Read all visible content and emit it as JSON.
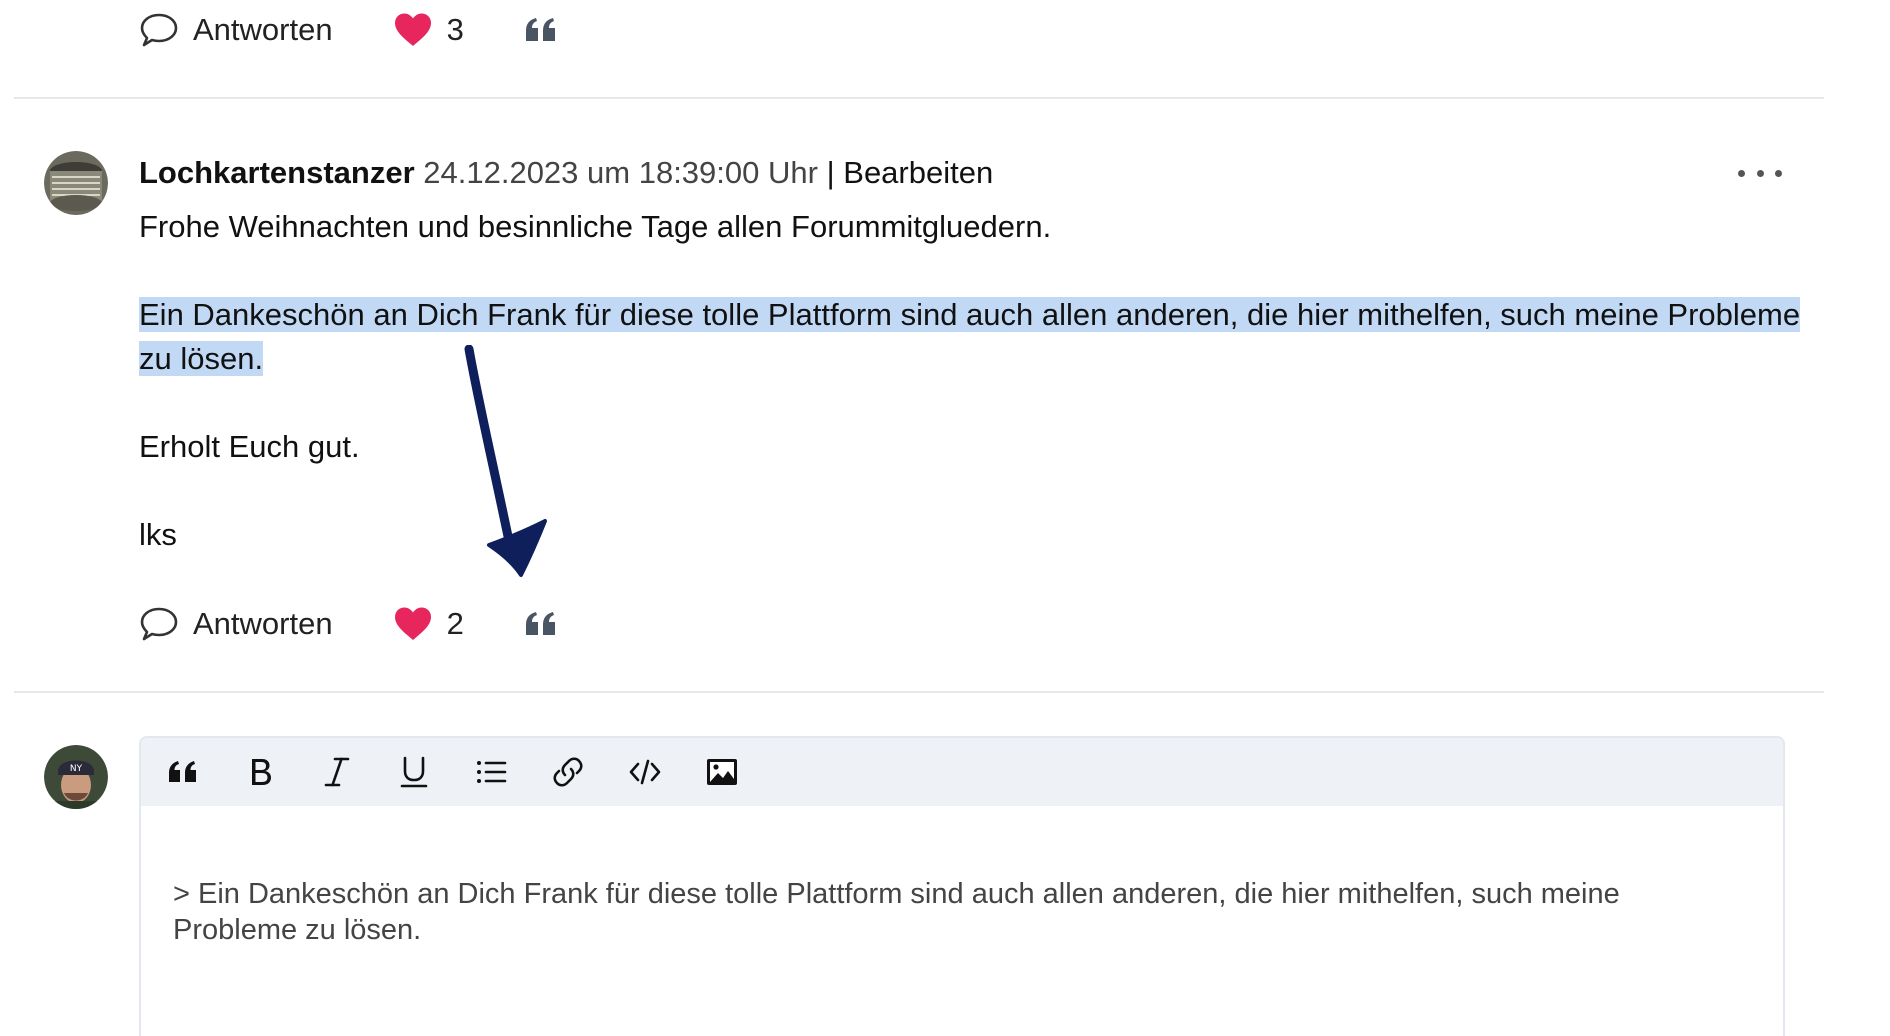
{
  "previous_post": {
    "reply_label": "Antworten",
    "likes": "3"
  },
  "post": {
    "author": "Lochkartenstanzer",
    "timestamp": "24.12.2023 um 18:39:00 Uhr",
    "separator": "|",
    "edit_label": "Bearbeiten",
    "paragraphs": [
      "Frohe Weihnachten und besinnliche Tage allen Forummitgluedern.",
      "Ein Dankeschön an Dich Frank für diese tolle Plattform sind auch allen anderen, die hier mithelfen, such meine Probleme zu lösen.",
      "Erholt Euch gut.",
      "lks"
    ],
    "highlight_color": "#c2d9f6",
    "reply_label": "Antworten",
    "likes": "2"
  },
  "editor": {
    "toolbar": [
      {
        "name": "quote-icon"
      },
      {
        "name": "bold-icon"
      },
      {
        "name": "italic-icon"
      },
      {
        "name": "underline-icon"
      },
      {
        "name": "list-icon"
      },
      {
        "name": "link-icon"
      },
      {
        "name": "code-icon"
      },
      {
        "name": "image-icon"
      }
    ],
    "content": "> Ein Dankeschön an Dich Frank für diese tolle Plattform sind auch allen anderen, die hier mithelfen, such meine Probleme zu lösen."
  },
  "colors": {
    "heart": "#e8265e",
    "toolbar_bg": "#eef2f6",
    "arrow": "#0f1f5c"
  }
}
